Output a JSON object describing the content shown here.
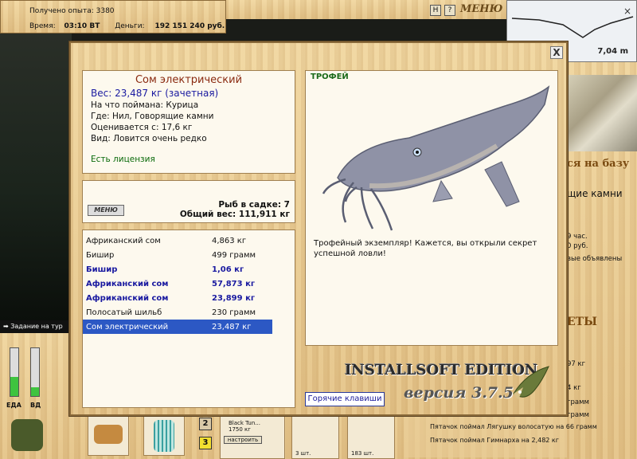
{
  "topbar": {
    "experience_label": "Получено опыта:",
    "experience_value": "3380",
    "time_label": "Время:",
    "time_value": "03:10 ВТ",
    "money_label": "Деньги:",
    "money_value": "192 151 240 руб.",
    "h_button": "H",
    "help_button": "?",
    "menu_button": "МЕНЮ"
  },
  "minimap": {
    "depth": "7,04 m"
  },
  "task": {
    "label": "Задание на тур"
  },
  "right_panel": {
    "banner": "ся на базу",
    "location": "щие камни",
    "lines": [
      "9 час.",
      "0 руб.",
      "вые объявлены"
    ],
    "section": "ЕТЫ",
    "weights": [
      "97 кг",
      "4 кг",
      "грамм",
      "грамм"
    ]
  },
  "gauges": {
    "food_label": "ЕДА",
    "drink_label": "ВД"
  },
  "slots": {
    "slot2": "2",
    "slot3": "3",
    "tackle_name": "Black Tun...",
    "tackle_weight": "1750 кг",
    "setup_button": "настроить",
    "count1": "3 шт.",
    "count2": "183 шт."
  },
  "messages": [
    "Пятачок поймал Лягушку волосатую на 66 грамм",
    "Пятачок поймал Гимнарха на 2,482 кг"
  ],
  "dialog": {
    "close": "X",
    "fish_name": "Сом электрический",
    "weight_line": "Вес: 23,487 кг (зачетная)",
    "bait_line": "На что поймана: Курица",
    "where_line": "Где: Нил, Говорящие камни",
    "valued_line": "Оценивается с: 17,6 кг",
    "kind_line": "Вид: Ловится очень редко",
    "license": "Есть лицензия",
    "menu_button": "МЕНЮ",
    "cage_count": "Рыб в садке: 7",
    "total_weight": "Общий вес: 111,911 кг",
    "catch_list": [
      {
        "name": "Африканский сом",
        "weight": "4,863 кг",
        "bold": false,
        "selected": false
      },
      {
        "name": "Бишир",
        "weight": "499 грамм",
        "bold": false,
        "selected": false
      },
      {
        "name": "Бишир",
        "weight": "1,06 кг",
        "bold": true,
        "selected": false
      },
      {
        "name": "Африканский сом",
        "weight": "57,873 кг",
        "bold": true,
        "selected": false
      },
      {
        "name": "Африканский сом",
        "weight": "23,899 кг",
        "bold": true,
        "selected": false
      },
      {
        "name": "Полосатый шильб",
        "weight": "230 грамм",
        "bold": false,
        "selected": false
      },
      {
        "name": "Сом электрический",
        "weight": "23,487 кг",
        "bold": false,
        "selected": true
      }
    ],
    "trophy_tag": "ТРОФЕЙ",
    "trophy_text": "Трофейный экземпляр! Кажется, вы открыли секрет успешной ловли!",
    "edition": "INSTALLSOFT EDITION",
    "version": "версия 3.7.5",
    "hotkeys": "Горячие клавиши"
  },
  "colors": {
    "wood": "#e9cd97",
    "selected_row": "#2c58c4",
    "bold_row": "#1a1aa0",
    "license": "#0a6a0a"
  }
}
